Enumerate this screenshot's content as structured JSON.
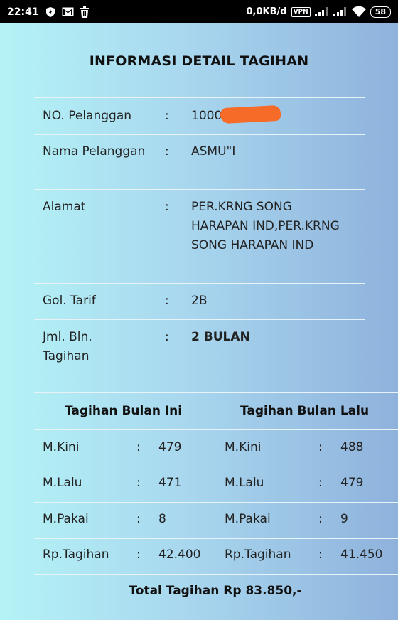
{
  "status_bar": {
    "time": "22:41",
    "net_speed": "0,0KB/d",
    "vpn": "VPN",
    "battery": "58"
  },
  "title": "INFORMASI DETAIL TAGIHAN",
  "details": [
    {
      "label": "NO. Pelanggan",
      "value": "100⁠0 ⁠ ⁠ ⁠ ⁠ ⁠ ⁠ ⁠ 792"
    },
    {
      "label": "Nama Pelanggan",
      "value": "ASMU\"I"
    },
    {
      "label": "Alamat",
      "value": "PER.KRNG SONG HARAPAN IND,PER.KRNG SONG HARAPAN IND"
    },
    {
      "label": "Gol. Tarif",
      "value": "2B"
    },
    {
      "label": "Jml. Bln. Tagihan",
      "value": "2 BULAN"
    }
  ],
  "separator": ":",
  "bulan_ini": {
    "heading": "Tagihan Bulan Ini",
    "rows": [
      {
        "label": "M.Kini",
        "value": "479"
      },
      {
        "label": "M.Lalu",
        "value": "471"
      },
      {
        "label": "M.Pakai",
        "value": "8"
      },
      {
        "label": "Rp.Tagihan",
        "value": "42.400"
      }
    ]
  },
  "bulan_lalu": {
    "heading": "Tagihan Bulan Lalu",
    "rows": [
      {
        "label": "M.Kini",
        "value": "488"
      },
      {
        "label": "M.Lalu",
        "value": "479"
      },
      {
        "label": "M.Pakai",
        "value": "9"
      },
      {
        "label": "Rp.Tagihan",
        "value": "41.450"
      }
    ]
  },
  "total": "Total Tagihan Rp 83.850,-"
}
